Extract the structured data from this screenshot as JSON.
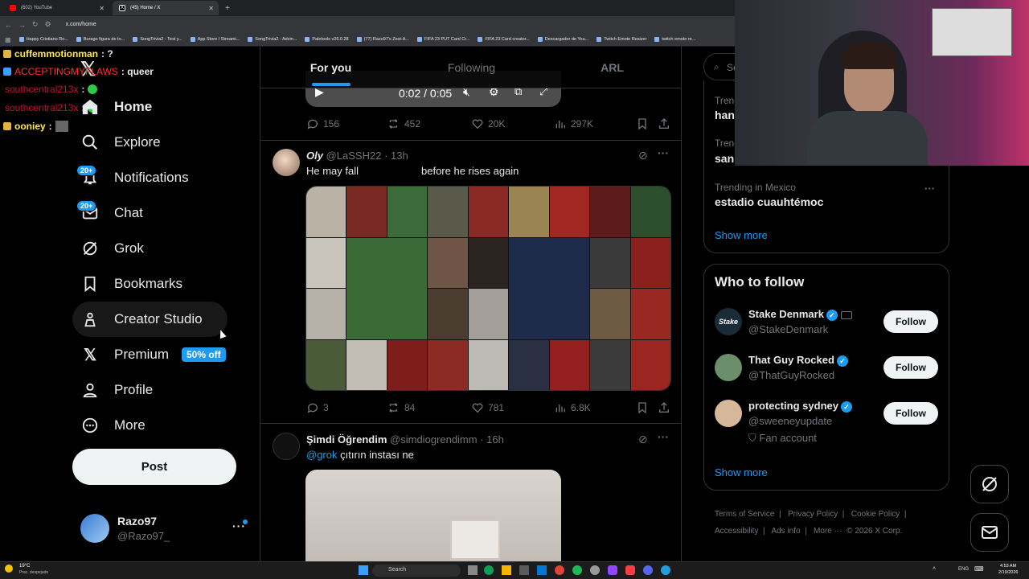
{
  "browser": {
    "tabs": [
      {
        "label": "(602) YouTube",
        "active": false
      },
      {
        "label": "(45) Home / X",
        "active": true
      }
    ],
    "url": "x.com/home",
    "bookmarks": [
      "Happy Cristiano Ro...",
      "Burago figura de to...",
      "SongTrivia2 - Test y...",
      "App Store / Streami...",
      "SongTrivia2 - Advin...",
      "Paletools v26.0.28",
      "(77) Razo97's Zest-A...",
      "FIFA 23 PUT Card Cr...",
      "FIFA 23 Card creator...",
      "Descargador de You...",
      "Twitch Emote Resizer",
      "twitch emote re..."
    ]
  },
  "chat": [
    {
      "user": "cuffemmotionman",
      "msg": ": ?",
      "color": "#ffe94a"
    },
    {
      "user": "ACCEPTINGMYFLAWS",
      "msg": ": queer",
      "color": "#ff2e2e"
    },
    {
      "user": "southcentral213x",
      "msg": ":",
      "color": "#c8102e"
    },
    {
      "user": "southcentral213x",
      "msg": ":",
      "color": "#c8102e"
    },
    {
      "user": "ooniey",
      "msg": ":",
      "color": "#ffe94a"
    }
  ],
  "nav": {
    "home": "Home",
    "explore": "Explore",
    "notifications": "Notifications",
    "notifications_badge": "20+",
    "chat": "Chat",
    "chat_badge": "20+",
    "grok": "Grok",
    "bookmarks": "Bookmarks",
    "creator_studio": "Creator Studio",
    "premium": "Premium",
    "premium_badge": "50% off",
    "profile": "Profile",
    "more": "More",
    "post": "Post"
  },
  "account": {
    "name": "Razo97",
    "handle": "@Razo97_"
  },
  "feed": {
    "tabs": [
      "For you",
      "Following",
      "ARL"
    ],
    "video": {
      "time": "0:02 / 0:05"
    },
    "post1_stats": {
      "replies": "156",
      "reposts": "452",
      "likes": "20K",
      "views": "297K"
    },
    "post2": {
      "name": "Oly",
      "handle": "@LaSSH22",
      "time": "· 13h",
      "text_a": "He may fall",
      "text_b": "before he rises again",
      "stats": {
        "replies": "3",
        "reposts": "84",
        "likes": "781",
        "views": "6.8K"
      }
    },
    "post3": {
      "name": "Şimdi Öğrendim",
      "handle": "@simdiogrendimm",
      "time": "· 16h",
      "mention": "@grok",
      "text": "çıtırın instası ne"
    }
  },
  "right": {
    "search_placeholder": "Se",
    "trends": [
      {
        "meta": "Trend",
        "topic": "hanı"
      },
      {
        "meta": "Trend",
        "topic": "san"
      },
      {
        "meta": "Trending in Mexico",
        "topic": "estadio cuauhtémoc"
      }
    ],
    "show_more": "Show more",
    "who_to_follow": "Who to follow",
    "follow_suggestions": [
      {
        "name": "Stake Denmark",
        "handle": "@StakeDenmark",
        "button": "Follow",
        "avatar_color": "#1a2c38",
        "avatar_text": "Stake"
      },
      {
        "name": "That Guy Rocked",
        "handle": "@ThatGuyRocked",
        "button": "Follow",
        "avatar_color": "#6b8f6b",
        "avatar_text": ""
      },
      {
        "name": "protecting sydney",
        "handle": "@sweeneyupdate",
        "button": "Follow",
        "note": "Fan account",
        "avatar_color": "#d7b79a",
        "avatar_text": ""
      }
    ],
    "show_more_2": "Show more",
    "footer": [
      "Terms of Service",
      "Privacy Policy",
      "Cookie Policy",
      "Accessibility",
      "Ads info",
      "More ···",
      "© 2026 X Corp."
    ]
  },
  "taskbar": {
    "weather_temp": "19°C",
    "weather_desc": "Prac. despejado",
    "search": "Search",
    "lang": "ENG",
    "time": "4:53 AM",
    "date": "2/19/2026"
  },
  "colors": {
    "accent": "#1d9bf0",
    "bg": "#000000",
    "border": "#2f3336",
    "muted": "#71767b"
  }
}
